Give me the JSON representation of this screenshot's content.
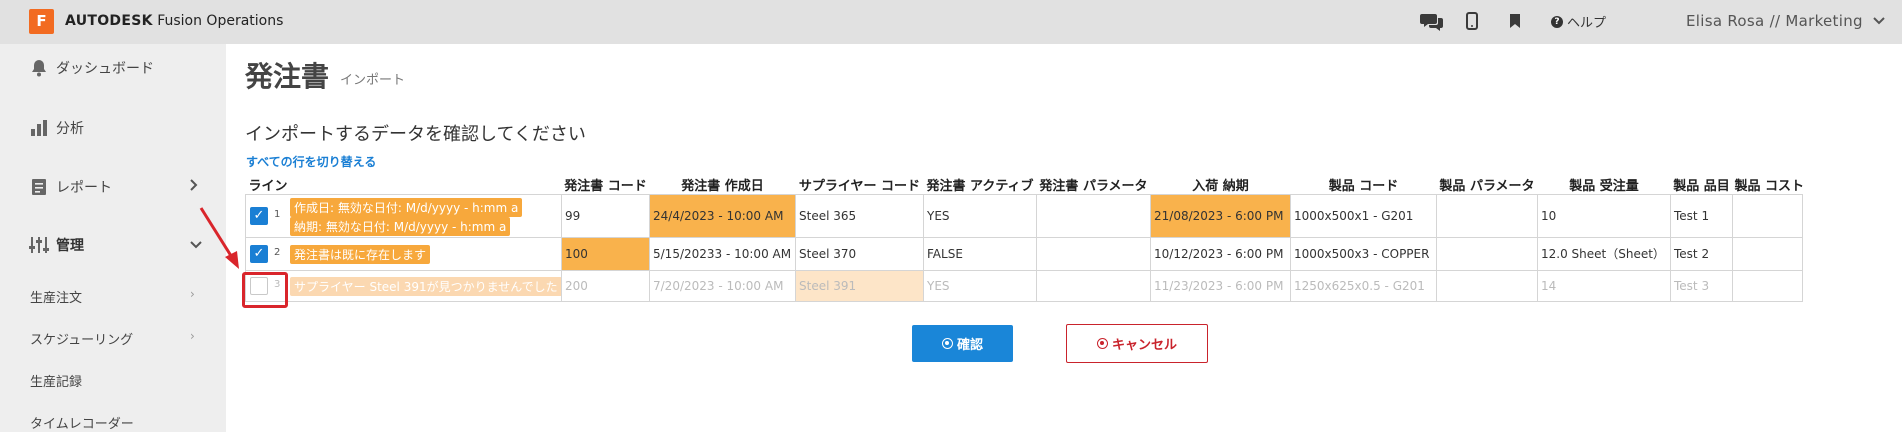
{
  "app": {
    "logo_letter": "F",
    "brand_bold": "AUTODESK",
    "brand_rest": "Fusion Operations",
    "help_label": "ヘルプ",
    "user_label": "Elisa Rosa // Marketing"
  },
  "sidebar": {
    "items": [
      {
        "label": "ダッシュボード"
      },
      {
        "label": "分析"
      },
      {
        "label": "レポート"
      },
      {
        "label": "管理"
      }
    ],
    "sub_items": [
      {
        "label": "生産注文"
      },
      {
        "label": "スケジューリング"
      },
      {
        "label": "生産記録"
      },
      {
        "label": "タイムレコーダー"
      }
    ]
  },
  "page": {
    "title": "発注書",
    "subtitle": "インポート",
    "section_title": "インポートするデータを確認してください",
    "toggle_rows_label": "すべての行を切り替える"
  },
  "table": {
    "headers": [
      "ライン",
      "発注書 コード",
      "発注書 作成日",
      "サプライヤー コード",
      "発注書 アクティブ",
      "発注書 パラメータ",
      "入荷 納期",
      "製品 コード",
      "製品 パラメータ",
      "製品 受注量",
      "製品 品目",
      "製品 コスト"
    ],
    "rows": [
      {
        "num": "1",
        "checked": true,
        "tags": [
          "作成日: 無効な日付: M/d/yyyy - h:mm a",
          "納期: 無効な日付: M/d/yyyy - h:mm a"
        ],
        "cells": [
          "99",
          "24/4/2023 - 10:00 AM",
          "Steel 365",
          "YES",
          "",
          "21/08/2023 - 6:00 PM",
          "1000x500x1 - G201",
          "",
          "10",
          "Test 1",
          ""
        ]
      },
      {
        "num": "2",
        "checked": true,
        "tags": [
          "発注書は既に存在します"
        ],
        "cells": [
          "100",
          "5/15/20233 - 10:00 AM",
          "Steel 370",
          "FALSE",
          "",
          "10/12/2023 - 6:00 PM",
          "1000x500x3 - COPPER",
          "",
          "12.0 Sheet（Sheet）",
          "Test 2",
          ""
        ]
      },
      {
        "num": "3",
        "checked": false,
        "tags": [
          "サプライヤー Steel 391が見つかりませんでした"
        ],
        "cells": [
          "200",
          "7/20/2023 - 10:00 AM",
          "Steel 391",
          "YES",
          "",
          "11/23/2023 - 6:00 PM",
          "1250x625x0.5 - G201",
          "",
          "14",
          "Test 3",
          ""
        ]
      }
    ]
  },
  "buttons": {
    "confirm_label": "確認",
    "cancel_label": "キャンセル"
  },
  "colors": {
    "accent": "#1a86d8",
    "warning": "#f9b24c",
    "danger": "#c9232c",
    "annotation": "#d9252b"
  }
}
